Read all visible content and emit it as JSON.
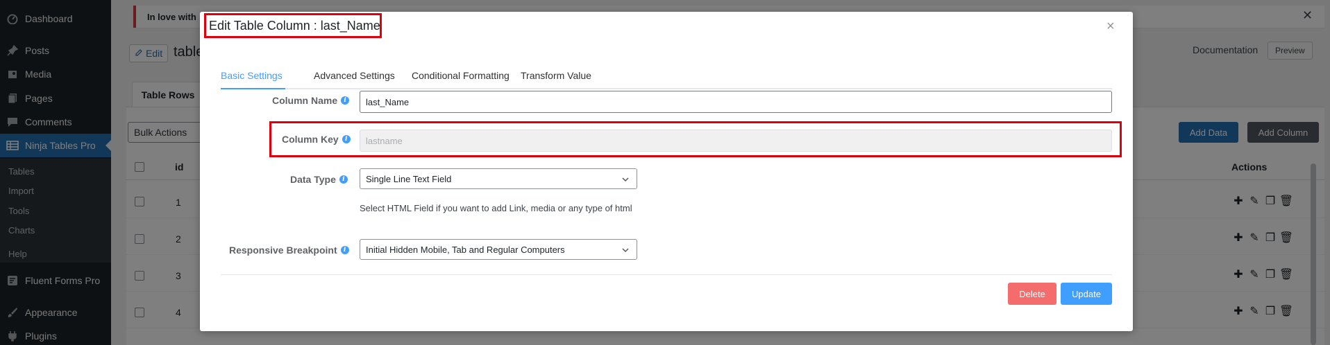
{
  "sidebar": {
    "items": [
      {
        "label": "Dashboard",
        "icon": "dashboard-icon"
      },
      {
        "label": "Posts",
        "icon": "pin-icon"
      },
      {
        "label": "Media",
        "icon": "media-icon"
      },
      {
        "label": "Pages",
        "icon": "pages-icon"
      },
      {
        "label": "Comments",
        "icon": "comment-icon"
      },
      {
        "label": "Ninja Tables Pro",
        "icon": "table-icon"
      },
      {
        "label": "Fluent Forms Pro",
        "icon": "form-icon"
      },
      {
        "label": "Appearance",
        "icon": "brush-icon"
      },
      {
        "label": "Plugins",
        "icon": "plugin-icon"
      }
    ],
    "submenu": [
      "Tables",
      "Import",
      "Tools",
      "Charts",
      "Help"
    ]
  },
  "page": {
    "notice": "In love with",
    "notice_close": "✕",
    "edit_label": "Edit",
    "table_title": "table",
    "documentation": "Documentation",
    "preview": "Preview",
    "tab_rows": "Table Rows",
    "bulk_actions": "Bulk Actions",
    "add_data": "Add Data",
    "add_column": "Add Column",
    "col_id": "id",
    "col_actions": "Actions",
    "row_ids": [
      "1",
      "2",
      "3",
      "4"
    ]
  },
  "modal": {
    "title": "Edit Table Column : last_Name",
    "close": "×",
    "tabs": [
      "Basic Settings",
      "Advanced Settings",
      "Conditional Formatting",
      "Transform Value"
    ],
    "column_name": {
      "label": "Column Name",
      "value": "last_Name"
    },
    "column_key": {
      "label": "Column Key",
      "placeholder": "lastname"
    },
    "data_type": {
      "label": "Data Type",
      "value": "Single Line Text Field",
      "help": "Select HTML Field if you want to add Link, media or any type of html"
    },
    "breakpoint": {
      "label": "Responsive Breakpoint",
      "value": "Initial Hidden Mobile, Tab and Regular Computers"
    },
    "delete": "Delete",
    "update": "Update"
  },
  "colors": {
    "primary": "#409eff",
    "danger": "#f56c6c",
    "wp_blue": "#2271b1",
    "highlight": "#e0000b"
  }
}
